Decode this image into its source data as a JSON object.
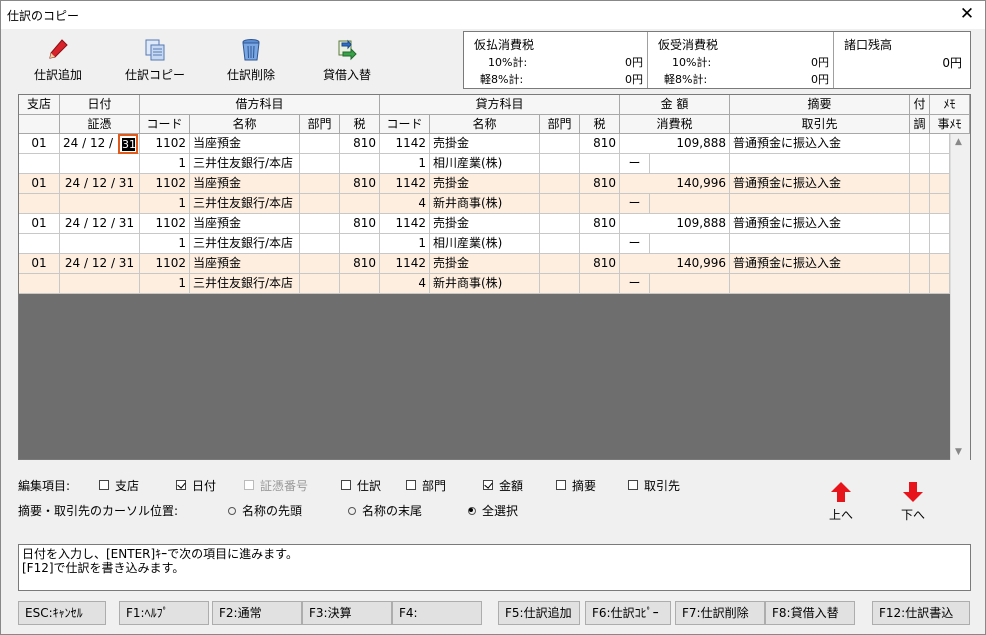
{
  "window": {
    "title": "仕訳のコピー",
    "close": "✕"
  },
  "toolbar": [
    {
      "label": "仕訳追加",
      "icon": "pen-icon"
    },
    {
      "label": "仕訳コピー",
      "icon": "copy-icon"
    },
    {
      "label": "仕訳削除",
      "icon": "trash-icon"
    },
    {
      "label": "貸借入替",
      "icon": "swap-icon"
    }
  ],
  "tax": {
    "paid": {
      "title": "仮払消費税",
      "r10_label": "10%計:",
      "r10_value": "0円",
      "r8_label": "軽8%計:",
      "r8_value": "0円"
    },
    "received": {
      "title": "仮受消費税",
      "r10_label": "10%計:",
      "r10_value": "0円",
      "r8_label": "軽8%計:",
      "r8_value": "0円"
    },
    "misc": {
      "title": "諸口残高",
      "value": "0円"
    }
  },
  "grid": {
    "headers_top": [
      "支店",
      "日付",
      "借方科目",
      "貸方科目",
      "金 額",
      "摘要",
      "付",
      "ﾒﾓ"
    ],
    "headers_bottom": [
      "証憑",
      "コード",
      "名称",
      "部門",
      "税",
      "コード",
      "名称",
      "部門",
      "税",
      "消費税",
      "取引先",
      "調",
      "事ﾒﾓ"
    ],
    "entries": [
      {
        "branch": "01",
        "date": "24 / 12 / ",
        "day": "31",
        "d_code": "1102",
        "d_name": "当座預金",
        "d_tax": "810",
        "c_code": "1142",
        "c_name": "売掛金",
        "c_tax": "810",
        "amount": "109,888",
        "memo": "普通預金に振込入金",
        "d_sub": "1",
        "d_sub_name": "三井住友銀行/本店",
        "c_sub": "1",
        "c_sub_name": "相川産業(株)",
        "dash": "ー"
      },
      {
        "branch": "01",
        "date": "24 / 12 / 31",
        "d_code": "1102",
        "d_name": "当座預金",
        "d_tax": "810",
        "c_code": "1142",
        "c_name": "売掛金",
        "c_tax": "810",
        "amount": "140,996",
        "memo": "普通預金に振込入金",
        "d_sub": "1",
        "d_sub_name": "三井住友銀行/本店",
        "c_sub": "4",
        "c_sub_name": "新井商事(株)",
        "dash": "ー"
      },
      {
        "branch": "01",
        "date": "24 / 12 / 31",
        "d_code": "1102",
        "d_name": "当座預金",
        "d_tax": "810",
        "c_code": "1142",
        "c_name": "売掛金",
        "c_tax": "810",
        "amount": "109,888",
        "memo": "普通預金に振込入金",
        "d_sub": "1",
        "d_sub_name": "三井住友銀行/本店",
        "c_sub": "1",
        "c_sub_name": "相川産業(株)",
        "dash": "ー"
      },
      {
        "branch": "01",
        "date": "24 / 12 / 31",
        "d_code": "1102",
        "d_name": "当座預金",
        "d_tax": "810",
        "c_code": "1142",
        "c_name": "売掛金",
        "c_tax": "810",
        "amount": "140,996",
        "memo": "普通預金に振込入金",
        "d_sub": "1",
        "d_sub_name": "三井住友銀行/本店",
        "c_sub": "4",
        "c_sub_name": "新井商事(株)",
        "dash": "ー"
      }
    ]
  },
  "edit": {
    "label": "編集項目:",
    "items": [
      {
        "label": "支店",
        "checked": false,
        "disabled": false
      },
      {
        "label": "日付",
        "checked": true,
        "disabled": false
      },
      {
        "label": "証憑番号",
        "checked": false,
        "disabled": true
      },
      {
        "label": "仕訳",
        "checked": false,
        "disabled": false
      },
      {
        "label": "部門",
        "checked": false,
        "disabled": false
      },
      {
        "label": "金額",
        "checked": true,
        "disabled": false
      },
      {
        "label": "摘要",
        "checked": false,
        "disabled": false
      },
      {
        "label": "取引先",
        "checked": false,
        "disabled": false
      }
    ]
  },
  "cursor": {
    "label": "摘要・取引先のカーソル位置:",
    "options": [
      {
        "label": "名称の先頭",
        "selected": false
      },
      {
        "label": "名称の末尾",
        "selected": false
      },
      {
        "label": "全選択",
        "selected": true
      }
    ]
  },
  "nav": {
    "up": "上へ",
    "down": "下へ",
    "color": "#e8141c"
  },
  "message": {
    "line1": "日付を入力し、[ENTER]ｷｰで次の項目に進みます。",
    "line2": "[F12]で仕訳を書き込みます。"
  },
  "fkeys": [
    "ESC:ｷｬﾝｾﾙ",
    "F1:ﾍﾙﾌﾟ",
    "F2:通常",
    "F3:決算",
    "F4:",
    "F5:仕訳追加",
    "F6:仕訳ｺﾋﾟｰ",
    "F7:仕訳削除",
    "F8:貸借入替",
    "F12:仕訳書込"
  ],
  "colors": {
    "alt_row": "#fdeee0",
    "grid_bg": "#6e6e6e"
  }
}
